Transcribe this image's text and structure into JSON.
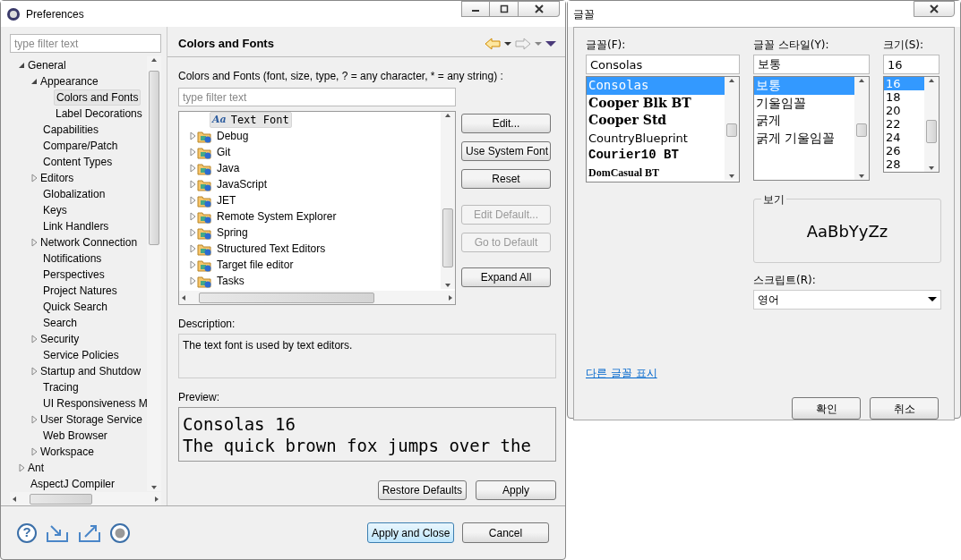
{
  "preferences": {
    "title": "Preferences",
    "filter": {
      "placeholder": "type filter text"
    },
    "tree": [
      {
        "label": "General",
        "expanded": true,
        "selected": false,
        "children": [
          {
            "label": "Appearance",
            "expanded": true,
            "selected": false,
            "children": [
              {
                "label": "Colors and Fonts",
                "selected": true
              },
              {
                "label": "Label Decorations",
                "selected": false
              }
            ]
          },
          {
            "label": "Capabilities",
            "selected": false
          },
          {
            "label": "Compare/Patch",
            "selected": false
          },
          {
            "label": "Content Types",
            "selected": false
          },
          {
            "label": "Editors",
            "expanded": false,
            "selected": false
          },
          {
            "label": "Globalization",
            "selected": false
          },
          {
            "label": "Keys",
            "selected": false
          },
          {
            "label": "Link Handlers",
            "selected": false
          },
          {
            "label": "Network Connection",
            "expanded": false,
            "selected": false
          },
          {
            "label": "Notifications",
            "selected": false
          },
          {
            "label": "Perspectives",
            "selected": false
          },
          {
            "label": "Project Natures",
            "selected": false
          },
          {
            "label": "Quick Search",
            "selected": false
          },
          {
            "label": "Search",
            "selected": false
          },
          {
            "label": "Security",
            "expanded": false,
            "selected": false
          },
          {
            "label": "Service Policies",
            "selected": false
          },
          {
            "label": "Startup and Shutdow",
            "expanded": false,
            "selected": false
          },
          {
            "label": "Tracing",
            "selected": false
          },
          {
            "label": "UI Responsiveness M",
            "selected": false
          },
          {
            "label": "User Storage Service",
            "expanded": false,
            "selected": false
          },
          {
            "label": "Web Browser",
            "selected": false
          },
          {
            "label": "Workspace",
            "expanded": false,
            "selected": false
          }
        ]
      },
      {
        "label": "Ant",
        "expanded": false,
        "selected": false
      },
      {
        "label": "AspectJ Compiler",
        "selected": false
      }
    ],
    "page": {
      "title": "Colors and Fonts",
      "hint": "Colors and Fonts (font, size, type, ? = any character, * = any string) :",
      "filter": {
        "placeholder": "type filter text"
      },
      "items": [
        {
          "label": "Text Font",
          "kind": "font",
          "icon_text": "Aa",
          "selected": true
        },
        {
          "label": "Debug",
          "kind": "category",
          "selected": false
        },
        {
          "label": "Git",
          "kind": "category",
          "selected": false
        },
        {
          "label": "Java",
          "kind": "category",
          "selected": false
        },
        {
          "label": "JavaScript",
          "kind": "category",
          "selected": false
        },
        {
          "label": "JET",
          "kind": "category",
          "selected": false
        },
        {
          "label": "Remote System Explorer",
          "kind": "category",
          "selected": false
        },
        {
          "label": "Spring",
          "kind": "category",
          "selected": false
        },
        {
          "label": "Structured Text Editors",
          "kind": "category",
          "selected": false
        },
        {
          "label": "Target file editor",
          "kind": "category",
          "selected": false
        },
        {
          "label": "Tasks",
          "kind": "category",
          "selected": false
        }
      ],
      "side_buttons": [
        {
          "label": "Edit...",
          "disabled": false
        },
        {
          "label": "Use System Font",
          "disabled": false
        },
        {
          "label": "Reset",
          "disabled": false
        },
        {
          "label": "Edit Default...",
          "disabled": true
        },
        {
          "label": "Go to Default",
          "disabled": true
        },
        {
          "label": "Expand All",
          "disabled": false
        }
      ],
      "description_label": "Description:",
      "description": "The text font is used by text editors.",
      "preview_label": "Preview:",
      "preview_lines": [
        "Consolas 16",
        "The quick brown fox jumps over the"
      ],
      "buttons": [
        "Restore Defaults",
        "Apply"
      ]
    },
    "footer": {
      "help": "?",
      "buttons": [
        {
          "label": "Apply and Close",
          "default": true
        },
        {
          "label": "Cancel",
          "default": false
        }
      ]
    }
  },
  "font_dialog": {
    "title": "글꼴",
    "font": {
      "label": "글꼴(F):",
      "value": "Consolas",
      "options": [
        {
          "label": "Consolas",
          "kind": "mono",
          "selected": true
        },
        {
          "label": "Cooper Blk BT",
          "kind": "heavy-serif",
          "selected": false
        },
        {
          "label": "Cooper Std",
          "kind": "heavy-serif",
          "selected": false
        },
        {
          "label": "CountryBlueprint",
          "kind": "sans",
          "selected": false
        },
        {
          "label": "Courier10 BT",
          "kind": "heavy-mono",
          "selected": false
        },
        {
          "label": "DomCasual BT",
          "kind": "casual",
          "selected": false
        }
      ]
    },
    "style": {
      "label": "글꼴 스타일(Y):",
      "value": "보통",
      "options": [
        {
          "label": "보통",
          "selected": true
        },
        {
          "label": "기울임꼴",
          "selected": false
        },
        {
          "label": "굵게",
          "selected": false
        },
        {
          "label": "굵게 기울임꼴",
          "selected": false
        }
      ]
    },
    "size": {
      "label": "크기(S):",
      "value": "16",
      "options": [
        {
          "label": "16",
          "selected": true
        },
        {
          "label": "18",
          "selected": false
        },
        {
          "label": "20",
          "selected": false
        },
        {
          "label": "22",
          "selected": false
        },
        {
          "label": "24",
          "selected": false
        },
        {
          "label": "26",
          "selected": false
        },
        {
          "label": "28",
          "selected": false
        }
      ]
    },
    "sample": {
      "label": "보기",
      "text": "AaBbYyZz"
    },
    "script": {
      "label": "스크립트(R):",
      "value": "영어"
    },
    "link": "다른 글꼴 표시",
    "buttons": [
      "확인",
      "취소"
    ]
  }
}
